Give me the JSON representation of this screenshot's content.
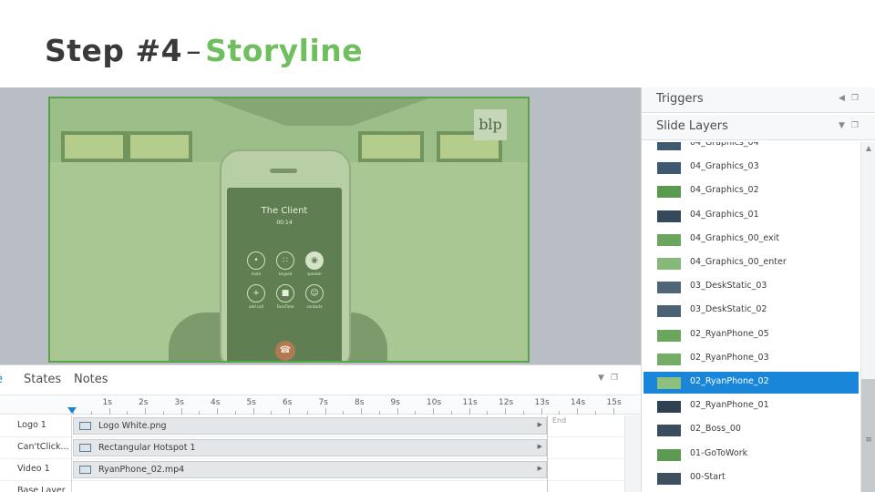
{
  "slide_title": {
    "step": "Step #4",
    "separator": "–",
    "accent": "Storyline"
  },
  "colors": {
    "accent": "#70bf5e",
    "selection": "#1a86d9",
    "title": "#3a3a3a"
  },
  "stage": {
    "logo_text": "blp",
    "phone": {
      "caller": "The Client",
      "duration": "00:14",
      "buttons": [
        {
          "icon": "mic-icon",
          "label": "mute",
          "active": false
        },
        {
          "icon": "keypad-icon",
          "label": "keypad",
          "active": false
        },
        {
          "icon": "speaker-icon",
          "label": "speaker",
          "active": true
        },
        {
          "icon": "plus-icon",
          "label": "add call",
          "active": false
        },
        {
          "icon": "video-icon",
          "label": "FaceTime",
          "active": false
        },
        {
          "icon": "contact-icon",
          "label": "contacts",
          "active": false
        }
      ],
      "end_call_icon": "end-call-icon"
    }
  },
  "right_panel": {
    "triggers": {
      "title": "Triggers",
      "collapse_icon": "chevron-left-icon",
      "window_icon": "restore-window-icon"
    },
    "slide_layers": {
      "title": "Slide Layers",
      "collapse_icon": "chevron-down-icon",
      "window_icon": "restore-window-icon",
      "items": [
        {
          "name": "04_Graphics_04",
          "thumb": "#3f5a6e",
          "selected": false
        },
        {
          "name": "04_Graphics_03",
          "thumb": "#3d5a70",
          "selected": false
        },
        {
          "name": "04_Graphics_02",
          "thumb": "#5a9a4e",
          "selected": false
        },
        {
          "name": "04_Graphics_01",
          "thumb": "#34495c",
          "selected": false
        },
        {
          "name": "04_Graphics_00_exit",
          "thumb": "#6aa75c",
          "selected": false
        },
        {
          "name": "04_Graphics_00_enter",
          "thumb": "#86b87a",
          "selected": false
        },
        {
          "name": "03_DeskStatic_03",
          "thumb": "#4e6678",
          "selected": false
        },
        {
          "name": "03_DeskStatic_02",
          "thumb": "#4a6274",
          "selected": false
        },
        {
          "name": "02_RyanPhone_05",
          "thumb": "#6aa75c",
          "selected": false
        },
        {
          "name": "02_RyanPhone_03",
          "thumb": "#74ad66",
          "selected": false
        },
        {
          "name": "02_RyanPhone_02",
          "thumb": "#8dc07e",
          "selected": true
        },
        {
          "name": "02_RyanPhone_01",
          "thumb": "#2e4253",
          "selected": false
        },
        {
          "name": "02_Boss_00",
          "thumb": "#3a4d5e",
          "selected": false
        },
        {
          "name": "01-GoToWork",
          "thumb": "#5b9a50",
          "selected": false
        },
        {
          "name": "00-Start",
          "thumb": "#3e4f60",
          "selected": false
        }
      ]
    },
    "scroll": {
      "up_icon": "scroll-up-icon",
      "grip_icon": "scroll-grip-icon"
    }
  },
  "timeline": {
    "tabs": [
      {
        "label": "e",
        "active": true
      },
      {
        "label": "States",
        "active": false
      },
      {
        "label": "Notes",
        "active": false
      }
    ],
    "collapse_icon": "chevron-down-icon",
    "window_icon": "restore-window-icon",
    "ruler": [
      "1s",
      "2s",
      "3s",
      "4s",
      "5s",
      "6s",
      "7s",
      "8s",
      "9s",
      "10s",
      "11s",
      "12s",
      "13s",
      "14s",
      "15s"
    ],
    "end_label": "End",
    "rows": [
      {
        "name": "Logo 1",
        "bar": {
          "icon": "image-icon",
          "label": "Logo White.png"
        }
      },
      {
        "name": "Can'tClick...",
        "bar": {
          "icon": "hotspot-icon",
          "label": "Rectangular Hotspot 1"
        }
      },
      {
        "name": "Video 1",
        "bar": {
          "icon": "video-file-icon",
          "label": "RyanPhone_02.mp4"
        }
      },
      {
        "name": "Base Layer",
        "bar": null
      }
    ]
  }
}
